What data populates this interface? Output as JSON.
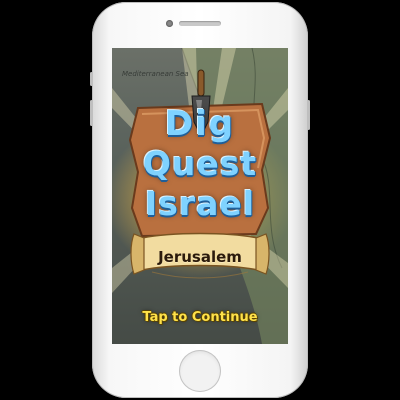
{
  "map": {
    "sea_label": "Mediterranean Sea"
  },
  "title": {
    "line1": "Dig",
    "line2": "Quest",
    "line3": "Israel"
  },
  "location": {
    "label": "Jerusalem"
  },
  "prompt": {
    "tap_label": "Tap to Continue"
  },
  "colors": {
    "title_fill": "#7fd2ff",
    "title_outline": "#1e5f9a",
    "prompt_yellow": "#ffe24a",
    "phone_body": "#f4f4f4"
  },
  "icons": [
    "trowel-icon",
    "scroll-banner-icon"
  ]
}
